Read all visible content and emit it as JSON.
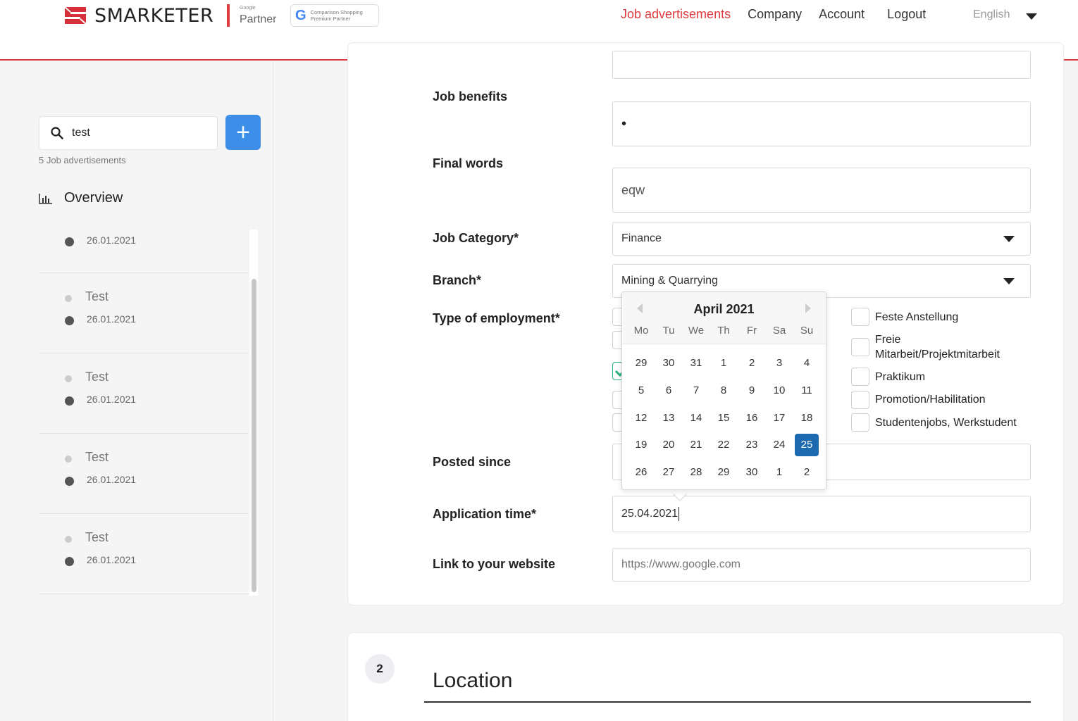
{
  "header": {
    "brand": "SMARKETER",
    "badge_google_small": "Google",
    "badge_google": "Partner",
    "badge_css_line1": "Comparison Shopping",
    "badge_css_line2": "Premium Partner",
    "nav": [
      "Job advertisements",
      "Company",
      "Account",
      "Logout"
    ],
    "language": "English",
    "accent": "#e0393e"
  },
  "sidebar": {
    "search_value": "test",
    "count_text": "5 Job advertisements",
    "overview_label": "Overview",
    "jobs": [
      {
        "title": "",
        "date": "26.01.2021"
      },
      {
        "title": "Test",
        "date": "26.01.2021"
      },
      {
        "title": "Test",
        "date": "26.01.2021"
      },
      {
        "title": "Test",
        "date": "26.01.2021"
      },
      {
        "title": "Test",
        "date": "26.01.2021"
      }
    ]
  },
  "form": {
    "job_benefits_label": "Job benefits",
    "job_benefits_value": "•",
    "final_words_label": "Final words",
    "final_words_value": "eqw",
    "job_category_label": "Job Category*",
    "job_category_value": "Finance",
    "branch_label": "Branch*",
    "branch_value": "Mining & Quarrying",
    "type_label": "Type of employment*",
    "employment_options": [
      "Feste Anstellung",
      "Freie Mitarbeit/Projektmitarbeit",
      "Praktikum",
      "Promotion/Habilitation",
      "Studentenjobs, Werkstudent"
    ],
    "posted_since_label": "Posted since",
    "application_time_label": "Application time*",
    "application_time_value": "25.04.2021",
    "website_label": "Link to your website",
    "website_placeholder": "https://www.google.com"
  },
  "datepicker": {
    "title": "April 2021",
    "weekdays": [
      "Mo",
      "Tu",
      "We",
      "Th",
      "Fr",
      "Sa",
      "Su"
    ],
    "weeks": [
      [
        "29",
        "30",
        "31",
        "1",
        "2",
        "3",
        "4"
      ],
      [
        "5",
        "6",
        "7",
        "8",
        "9",
        "10",
        "11"
      ],
      [
        "12",
        "13",
        "14",
        "15",
        "16",
        "17",
        "18"
      ],
      [
        "19",
        "20",
        "21",
        "22",
        "23",
        "24",
        "25"
      ],
      [
        "26",
        "27",
        "28",
        "29",
        "30",
        "1",
        "2"
      ]
    ],
    "selected": "25",
    "selected_color": "#1e6ab0"
  },
  "location": {
    "step": "2",
    "title": "Location"
  }
}
